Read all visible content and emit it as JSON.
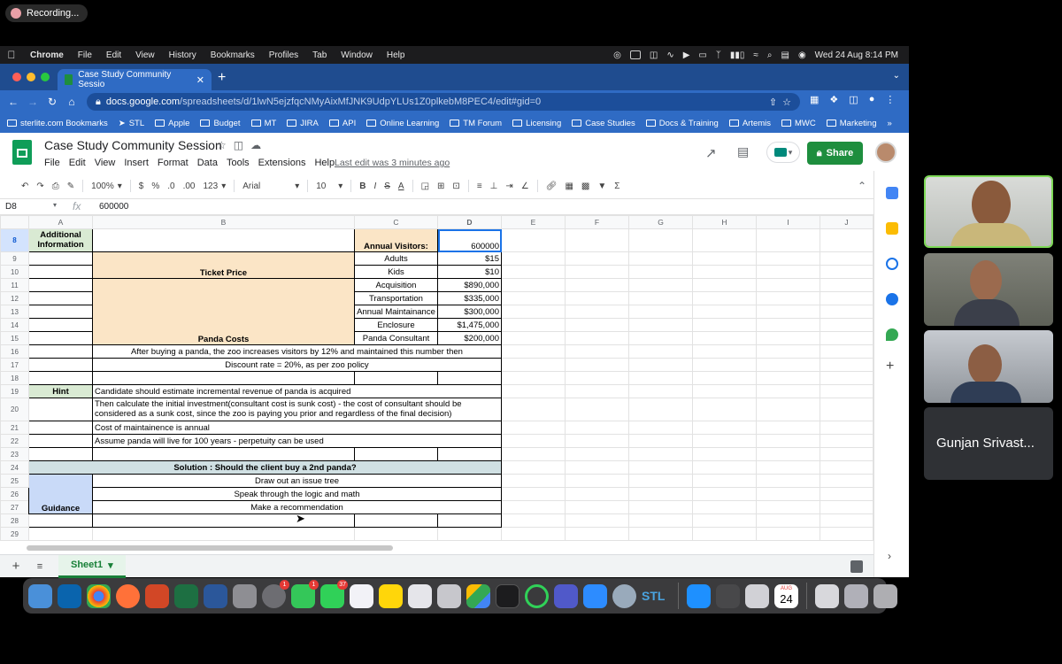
{
  "recording": {
    "label": "Recording..."
  },
  "menubar": {
    "items": [
      "Chrome",
      "File",
      "Edit",
      "View",
      "History",
      "Bookmarks",
      "Profiles",
      "Tab",
      "Window",
      "Help"
    ],
    "clock": "Wed 24 Aug  8:14 PM"
  },
  "browser": {
    "tab_title": "Case Study Community Sessio",
    "url_host": "docs.google.com",
    "url_path": "/spreadsheets/d/1lwN5ejzfqcNMyAixMfJNK9UdpYLUs1Z0plkebM8PEC4/edit#gid=0",
    "bookmarks": [
      "sterlite.com Bookmarks",
      "STL",
      "Apple",
      "Budget",
      "MT",
      "JIRA",
      "API",
      "Online Learning",
      "TM Forum",
      "Licensing",
      "Case Studies",
      "Docs & Training",
      "Artemis",
      "MWC",
      "Marketing"
    ],
    "bookmarks_more": "»"
  },
  "sheets": {
    "title": "Case Study Community Session",
    "menus": [
      "File",
      "Edit",
      "View",
      "Insert",
      "Format",
      "Data",
      "Tools",
      "Extensions",
      "Help"
    ],
    "last_edit": "Last edit was 3 minutes ago",
    "share_label": "Share",
    "toolbar": {
      "zoom": "100%",
      "currency": "$",
      "percent": "%",
      "dec_less": ".0",
      "dec_more": ".00",
      "format_more": "123",
      "font": "Arial",
      "font_size": "10"
    },
    "namebox": "D8",
    "fx": "fx",
    "formula_value": "600000",
    "sheet_tab": "Sheet1",
    "columns": [
      "A",
      "B",
      "C",
      "D",
      "E",
      "F",
      "G",
      "H",
      "I",
      "J"
    ],
    "rows": [
      "8",
      "9",
      "10",
      "11",
      "12",
      "13",
      "14",
      "15",
      "16",
      "17",
      "18",
      "19",
      "20",
      "21",
      "22",
      "23",
      "24",
      "25",
      "26",
      "27",
      "28",
      "29"
    ],
    "cells": {
      "a8": "Additional Information",
      "c8": "Annual Visitors:",
      "d8": "600000",
      "c9": "Adults",
      "d9": "$15",
      "b10": "Ticket Price",
      "c10": "Kids",
      "d10": "$10",
      "c11": "Acquisition",
      "d11": "$890,000",
      "c12": "Transportation",
      "d12": "$335,000",
      "c13": "Annual Maintainance",
      "d13": "$300,000",
      "c14": "Enclosure",
      "d14": "$1,475,000",
      "b15": "Panda Costs",
      "c15": "Panda Consultant",
      "d15": "$200,000",
      "b16": "After buying a panda, the zoo increases visitors by 12% and maintained this number then",
      "b17": "Discount rate = 20%, as per zoo policy",
      "a19": "Hint",
      "b19": "Candidate should estimate incremental revenue of panda is acquired",
      "b20": "Then calculate the initial investment(consultant cost is sunk cost) - the cost of consultant should be considered as a sunk cost, since the zoo is paying you prior and regardless of the final decision)",
      "b21": "Cost of maintainence is annual",
      "b22": "Assume panda will live for 100 years - perpetuity can be used",
      "a24": "Solution : Should the client buy a 2nd panda?",
      "b25": "Draw out an issue tree",
      "b26": "Speak through the logic and math",
      "a27": "Guidance",
      "b27": "Make a recommendation"
    }
  },
  "dock": {
    "badges": {
      "app1": "1",
      "app2": "1",
      "app3": "37"
    },
    "calendar_month": "AUG",
    "calendar_day": "24",
    "stl_label": "STL"
  },
  "participants": [
    {
      "name": ""
    },
    {
      "name": ""
    },
    {
      "name": ""
    },
    {
      "name": "Gunjan Srivast..."
    }
  ],
  "colors": {
    "sheets_green": "#1e8e3e",
    "chrome_blue": "#2f6bc4",
    "speaking_border": "#7ed957"
  }
}
